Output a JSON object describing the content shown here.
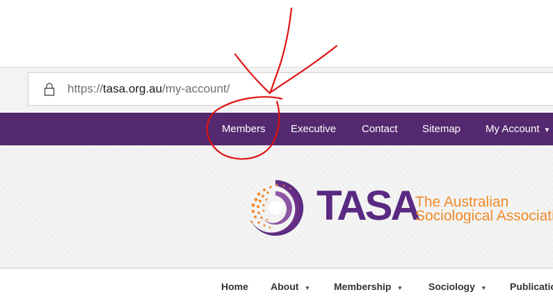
{
  "browser": {
    "url_prefix": "https://",
    "url_domain": "tasa.org.au",
    "url_path": "/my-account/"
  },
  "top_nav": {
    "items": [
      {
        "label": "Members"
      },
      {
        "label": "Executive"
      },
      {
        "label": "Contact"
      },
      {
        "label": "Sitemap"
      },
      {
        "label": "My Account",
        "has_dropdown": true
      }
    ],
    "background": "#54296f"
  },
  "header": {
    "logo_word": "TASA",
    "tagline_line1": "The Australian",
    "tagline_line2": "Sociological Association",
    "brand_purple": "#5a2a82",
    "brand_orange": "#ef8a28"
  },
  "main_nav": {
    "items": [
      {
        "label": "Home"
      },
      {
        "label": "About",
        "has_dropdown": true
      },
      {
        "label": "Membership",
        "has_dropdown": true
      },
      {
        "label": "Sociology",
        "has_dropdown": true
      },
      {
        "label": "Publications"
      }
    ]
  },
  "annotation": {
    "color": "#e01010",
    "description_icon": "hand-drawn-arrow-and-circle"
  }
}
